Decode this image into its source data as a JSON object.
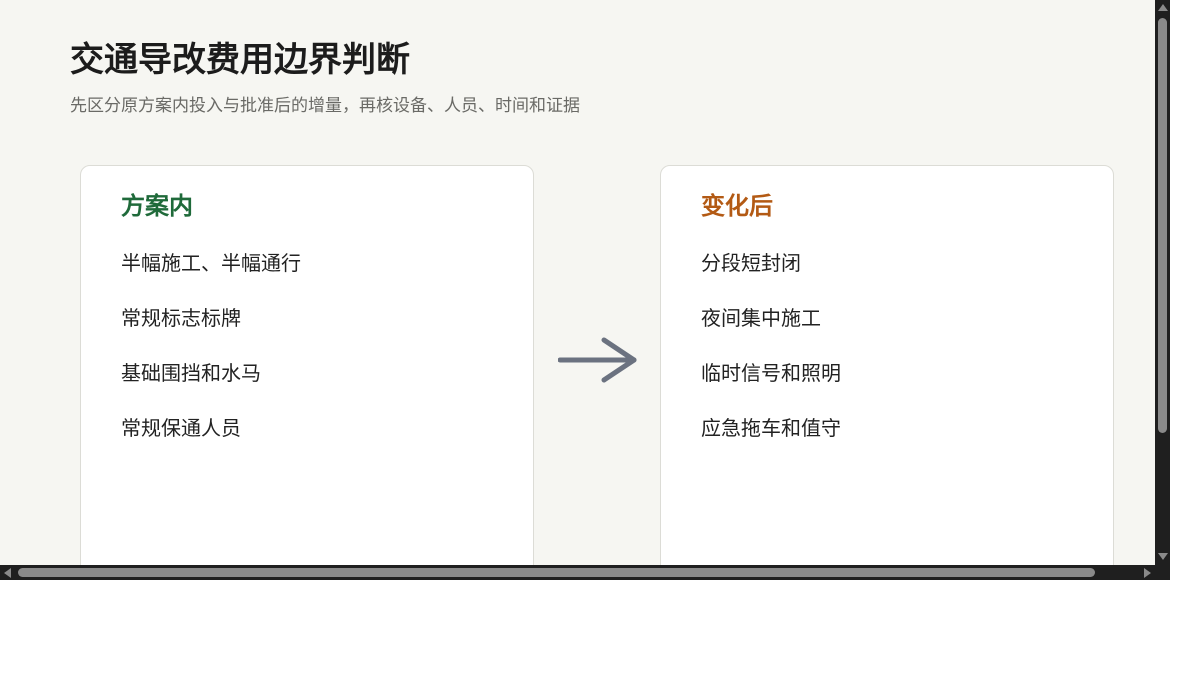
{
  "header": {
    "title": "交通导改费用边界判断",
    "subtitle": "先区分原方案内投入与批准后的增量，再核设备、人员、时间和证据"
  },
  "left_card": {
    "heading": "方案内",
    "heading_color": "#1f6a3a",
    "items": [
      "半幅施工、半幅通行",
      "常规标志标牌",
      "基础围挡和水马",
      "常规保通人员"
    ]
  },
  "right_card": {
    "heading": "变化后",
    "heading_color": "#b35a14",
    "items": [
      "分段短封闭",
      "夜间集中施工",
      "临时信号和照明",
      "应急拖车和值守"
    ]
  },
  "arrow": {
    "icon": "arrow-right-icon",
    "color": "#6b7280"
  }
}
